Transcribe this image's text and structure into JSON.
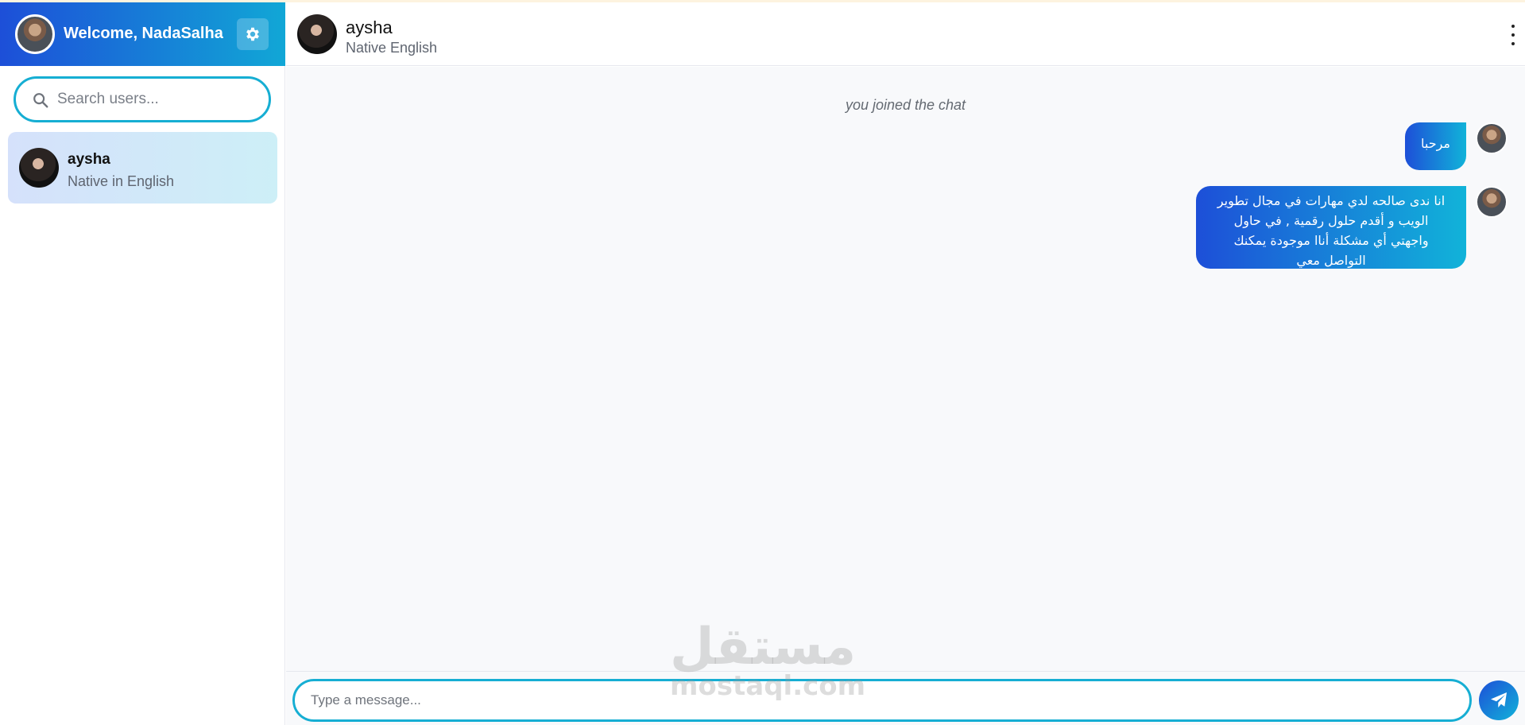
{
  "sidebar": {
    "welcome_text": "Welcome, NadaSalha",
    "settings_icon": "gear-icon",
    "search": {
      "placeholder": "Search users...",
      "value": ""
    },
    "users": [
      {
        "name": "aysha",
        "subtitle": "Native in English"
      }
    ]
  },
  "chat": {
    "header": {
      "name": "aysha",
      "subtitle": "Native English",
      "menu_icon": "kebab-menu-icon"
    },
    "system_message": "you joined the chat",
    "messages": [
      {
        "text": "مرحبا",
        "sender": "me"
      },
      {
        "text": "انا ندى صالحه لدي مهارات في مجال تطوير الويب و أقدم حلول رقمية , في حاول واجهتي أي مشكلة أنا​ا موجودة يمكنك التواصل معي",
        "sender": "me"
      }
    ],
    "composer": {
      "placeholder": "Type a message...",
      "value": "",
      "send_icon": "paper-plane-icon"
    }
  },
  "watermark": {
    "arabic": "مستقل",
    "latin": "mostaql.com"
  },
  "colors": {
    "accent_start": "#1d4fd8",
    "accent_end": "#11b3d9",
    "input_border": "#16aed3"
  }
}
